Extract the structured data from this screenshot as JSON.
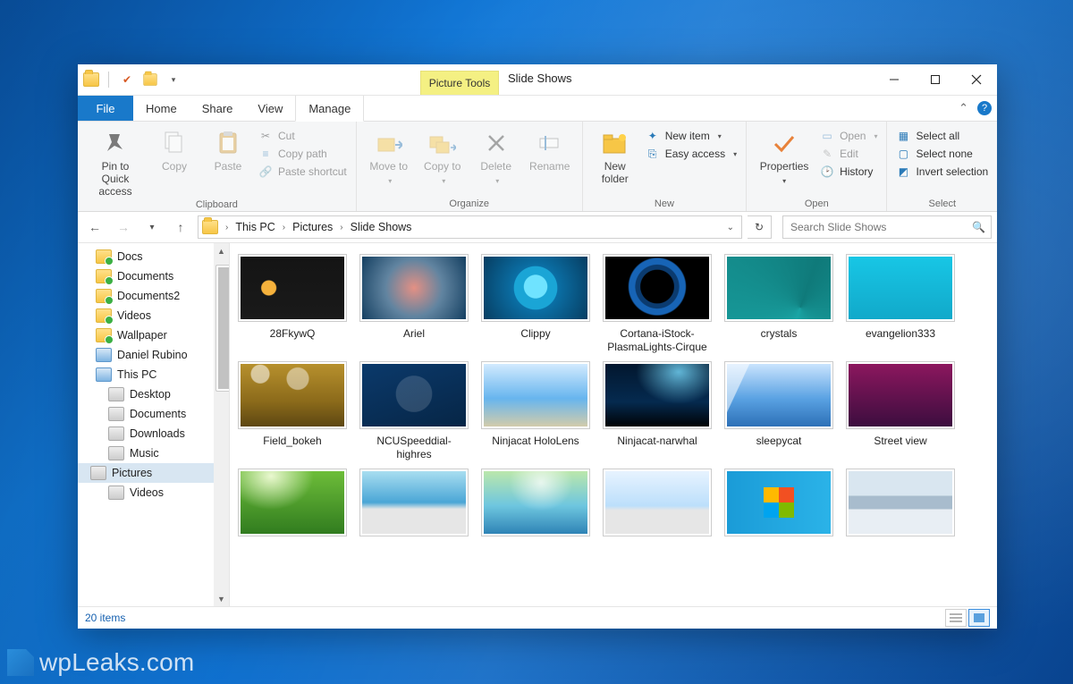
{
  "title": "Slide Shows",
  "context_tab": "Picture Tools",
  "tabs": {
    "file": "File",
    "home": "Home",
    "share": "Share",
    "view": "View",
    "manage": "Manage"
  },
  "ribbon": {
    "clipboard": {
      "label": "Clipboard",
      "pin": "Pin to Quick access",
      "copy": "Copy",
      "paste": "Paste",
      "cut": "Cut",
      "copy_path": "Copy path",
      "paste_shortcut": "Paste shortcut"
    },
    "organize": {
      "label": "Organize",
      "move_to": "Move to",
      "copy_to": "Copy to",
      "delete": "Delete",
      "rename": "Rename"
    },
    "new": {
      "label": "New",
      "new_folder": "New folder",
      "new_item": "New item",
      "easy_access": "Easy access"
    },
    "open": {
      "label": "Open",
      "properties": "Properties",
      "open": "Open",
      "edit": "Edit",
      "history": "History"
    },
    "select": {
      "label": "Select",
      "select_all": "Select all",
      "select_none": "Select none",
      "invert": "Invert selection"
    }
  },
  "breadcrumb": [
    "This PC",
    "Pictures",
    "Slide Shows"
  ],
  "search_placeholder": "Search Slide Shows",
  "tree": [
    {
      "label": "Docs",
      "icon": "folder-sync",
      "depth": 0
    },
    {
      "label": "Documents",
      "icon": "folder-sync",
      "depth": 0
    },
    {
      "label": "Documents2",
      "icon": "folder-sync",
      "depth": 0
    },
    {
      "label": "Videos",
      "icon": "folder-sync",
      "depth": 0
    },
    {
      "label": "Wallpaper",
      "icon": "folder-sync",
      "depth": 0
    },
    {
      "label": "Daniel Rubino",
      "icon": "user",
      "depth": 0
    },
    {
      "label": "This PC",
      "icon": "pc",
      "depth": 0
    },
    {
      "label": "Desktop",
      "icon": "disk",
      "depth": 1
    },
    {
      "label": "Documents",
      "icon": "disk",
      "depth": 1
    },
    {
      "label": "Downloads",
      "icon": "disk",
      "depth": 1
    },
    {
      "label": "Music",
      "icon": "disk",
      "depth": 1
    },
    {
      "label": "Pictures",
      "icon": "disk",
      "depth": 1,
      "selected": true
    },
    {
      "label": "Videos",
      "icon": "disk",
      "depth": 1
    }
  ],
  "items": [
    {
      "name": "28FkywQ",
      "bg": "radial-gradient(circle at 28% 50%, #f6b23c 8px, transparent 9px), linear-gradient(#141414,#1a1a1a)"
    },
    {
      "name": "Ariel",
      "bg": "radial-gradient(circle at 50% 50%, rgba(210,70,50,.6), rgba(30,80,120,.7) 45%, #0e3a5c)"
    },
    {
      "name": "Clippy",
      "bg": "radial-gradient(circle at 50% 48%, #6fe3ff 18%, transparent 19%), radial-gradient(circle at 50% 50%, #1aa5d6 34%, #0b6fa5 35%, #063a5d)"
    },
    {
      "name": "Cortana-iStock-PlasmaLights-Cirque",
      "bg": "radial-gradient(circle at 50% 48%, #000 26%, transparent 27%), radial-gradient(circle at 50% 48%, #0b3b6f 34%, transparent 35%), radial-gradient(circle at 50% 48%, #1764b6 44%, #000 46%)"
    },
    {
      "name": "crystals",
      "bg": "conic-gradient(from 200deg at 70% 80%, #1aa5a5, #0f7a7a, #1aa5a5), linear-gradient(#18b2a6,#0c8a80)"
    },
    {
      "name": "evangelion333",
      "bg": "linear-gradient(#18c7e6,#11a8c9)"
    },
    {
      "name": "Field_bokeh",
      "bg": "radial-gradient(circle at 20% 18%, rgba(255,255,255,.55) 10px, transparent 11px), radial-gradient(circle at 55% 25%, rgba(255,255,255,.45) 12px, transparent 13px), linear-gradient(180deg,#b9922e 0%, #8b6a1a 60%, #5a4512 100%)"
    },
    {
      "name": "NCUSpeeddial-highres",
      "bg": "radial-gradient(circle at 50% 48%, rgba(255,255,255,.15) 28%, transparent 29%), linear-gradient(160deg,#0b3a6c,#062545)"
    },
    {
      "name": "Ninjacat HoloLens",
      "bg": "linear-gradient(180deg,#d7edff 0%, #67b5ee 55%, #d9cda6 100%)"
    },
    {
      "name": "Ninjacat-narwhal",
      "bg": "radial-gradient(ellipse at 70% 15%, rgba(120,220,255,.8), transparent 40%), linear-gradient(180deg,#02162d,#052a4f 60%, #000)"
    },
    {
      "name": "sleepycat",
      "bg": "linear-gradient(115deg, rgba(255,255,255,.55) 0 18%, transparent 18.5%), linear-gradient(180deg,#cfe7ff 0%, #5aa2e3 55%, #2a6db4 100%)"
    },
    {
      "name": "Street view",
      "bg": "linear-gradient(180deg,#8e175f 0%, #3a0d3e 100%)"
    },
    {
      "name": "",
      "bg": "radial-gradient(ellipse at 30% 10%, #eaf8d0, transparent 40%), linear-gradient(180deg,#6fbf3a 0%, #2f7a1e 100%)"
    },
    {
      "name": "",
      "bg": "linear-gradient(180deg,#aee1f2 0%, #4aa6d6 50%, #e6e6e6 60%)"
    },
    {
      "name": "",
      "bg": "radial-gradient(ellipse at 55% 20%, rgba(255,255,255,.75), transparent 38%), linear-gradient(180deg,#bfe9a9 0%, #6ec6df 55%, #2a7fb3 100%)"
    },
    {
      "name": "",
      "bg": "linear-gradient(180deg,#e9f4ff 0%, #bcdffb 55%, #e6e6e6 62%)"
    },
    {
      "name": "",
      "bg": "conic-gradient(from 0deg at 50% 50%, #f25022 0 25%, #7fba00 0 50%, #00a4ef 0 75%, #ffb900 0 100%)",
      "bgExtra": "linear-gradient(90deg,#1a9bd7,#2bb3e8)"
    },
    {
      "name": "",
      "bg": "linear-gradient(180deg,#d9e6f0 0 40%, #a8bccd 40% 60%, #e8eef4 60% 100%)"
    }
  ],
  "status": {
    "count_label": "20 items"
  },
  "watermark": "wpLeaks.com"
}
